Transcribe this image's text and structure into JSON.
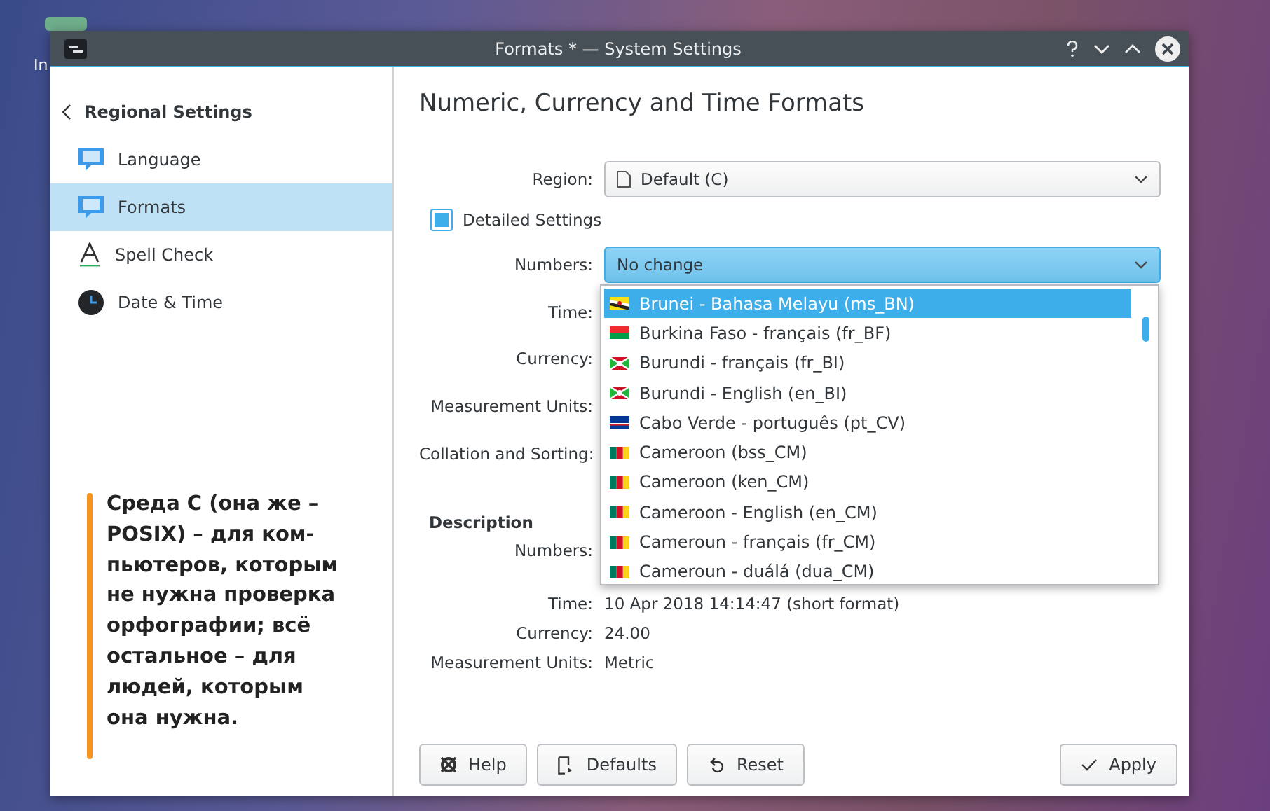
{
  "desktop": {
    "icon_label": "In"
  },
  "window": {
    "title": "Formats * — System Settings"
  },
  "sidebar": {
    "back_label": "Regional Settings",
    "items": [
      {
        "label": "Language",
        "kind": "bubble",
        "selected": false
      },
      {
        "label": "Formats",
        "kind": "bubble",
        "selected": true
      },
      {
        "label": "Spell Check",
        "kind": "letter",
        "selected": false
      },
      {
        "label": "Date & Time",
        "kind": "clock",
        "selected": false
      }
    ]
  },
  "page": {
    "title": "Numeric, Currency and Time Formats",
    "region": {
      "label": "Region:",
      "value": "Default (C)"
    },
    "detailed": {
      "label": "Detailed Settings",
      "checked": true
    },
    "settings": [
      {
        "label": "Numbers:",
        "value": "No change",
        "focused": true
      },
      {
        "label": "Time:"
      },
      {
        "label": "Currency:"
      },
      {
        "label": "Measurement Units:"
      },
      {
        "label": "Collation and Sorting:"
      }
    ],
    "description": {
      "title": "Description",
      "rows": [
        {
          "label": "Numbers:"
        },
        {
          "label": "Time:",
          "lines": [
            "10 Apr 2018 14:14:47 (short format)"
          ]
        },
        {
          "label": "Currency:",
          "lines": [
            "24.00"
          ]
        },
        {
          "label": "Measurement Units:",
          "lines": [
            "Metric"
          ]
        }
      ]
    }
  },
  "dropdown": {
    "items": [
      {
        "label": "Brunei - Bahasa Melayu (ms_BN)",
        "kind": "brunei",
        "selected": true
      },
      {
        "label": "Burkina Faso - français (fr_BF)",
        "kind": "burkina",
        "selected": false
      },
      {
        "label": "Burundi - français (fr_BI)",
        "kind": "burundi",
        "selected": false
      },
      {
        "label": "Burundi - English (en_BI)",
        "kind": "burundi",
        "selected": false
      },
      {
        "label": "Cabo Verde - português (pt_CV)",
        "kind": "caboverde",
        "selected": false
      },
      {
        "label": "Cameroon (bss_CM)",
        "kind": "cameroon",
        "selected": false
      },
      {
        "label": "Cameroon (ken_CM)",
        "kind": "cameroon",
        "selected": false
      },
      {
        "label": "Cameroon - English (en_CM)",
        "kind": "cameroon",
        "selected": false
      },
      {
        "label": "Cameroun - français (fr_CM)",
        "kind": "cameroon",
        "selected": false
      },
      {
        "label": "Cameroun - duálá (dua_CM)",
        "kind": "cameroon",
        "selected": false
      }
    ]
  },
  "buttons": [
    {
      "label": "Help",
      "kind": "help"
    },
    {
      "label": "Defaults",
      "kind": "defaults"
    },
    {
      "label": "Reset",
      "kind": "reset"
    },
    {
      "label": "Apply",
      "kind": "apply"
    }
  ],
  "callout": {
    "lines": [
      "Среда C (она же –",
      "POSIX) – для ком-",
      "пьютеров, которым",
      "не нужна проверка",
      "орфографии; всё",
      "остальное – для",
      "людей, которым",
      "она нужна."
    ]
  }
}
